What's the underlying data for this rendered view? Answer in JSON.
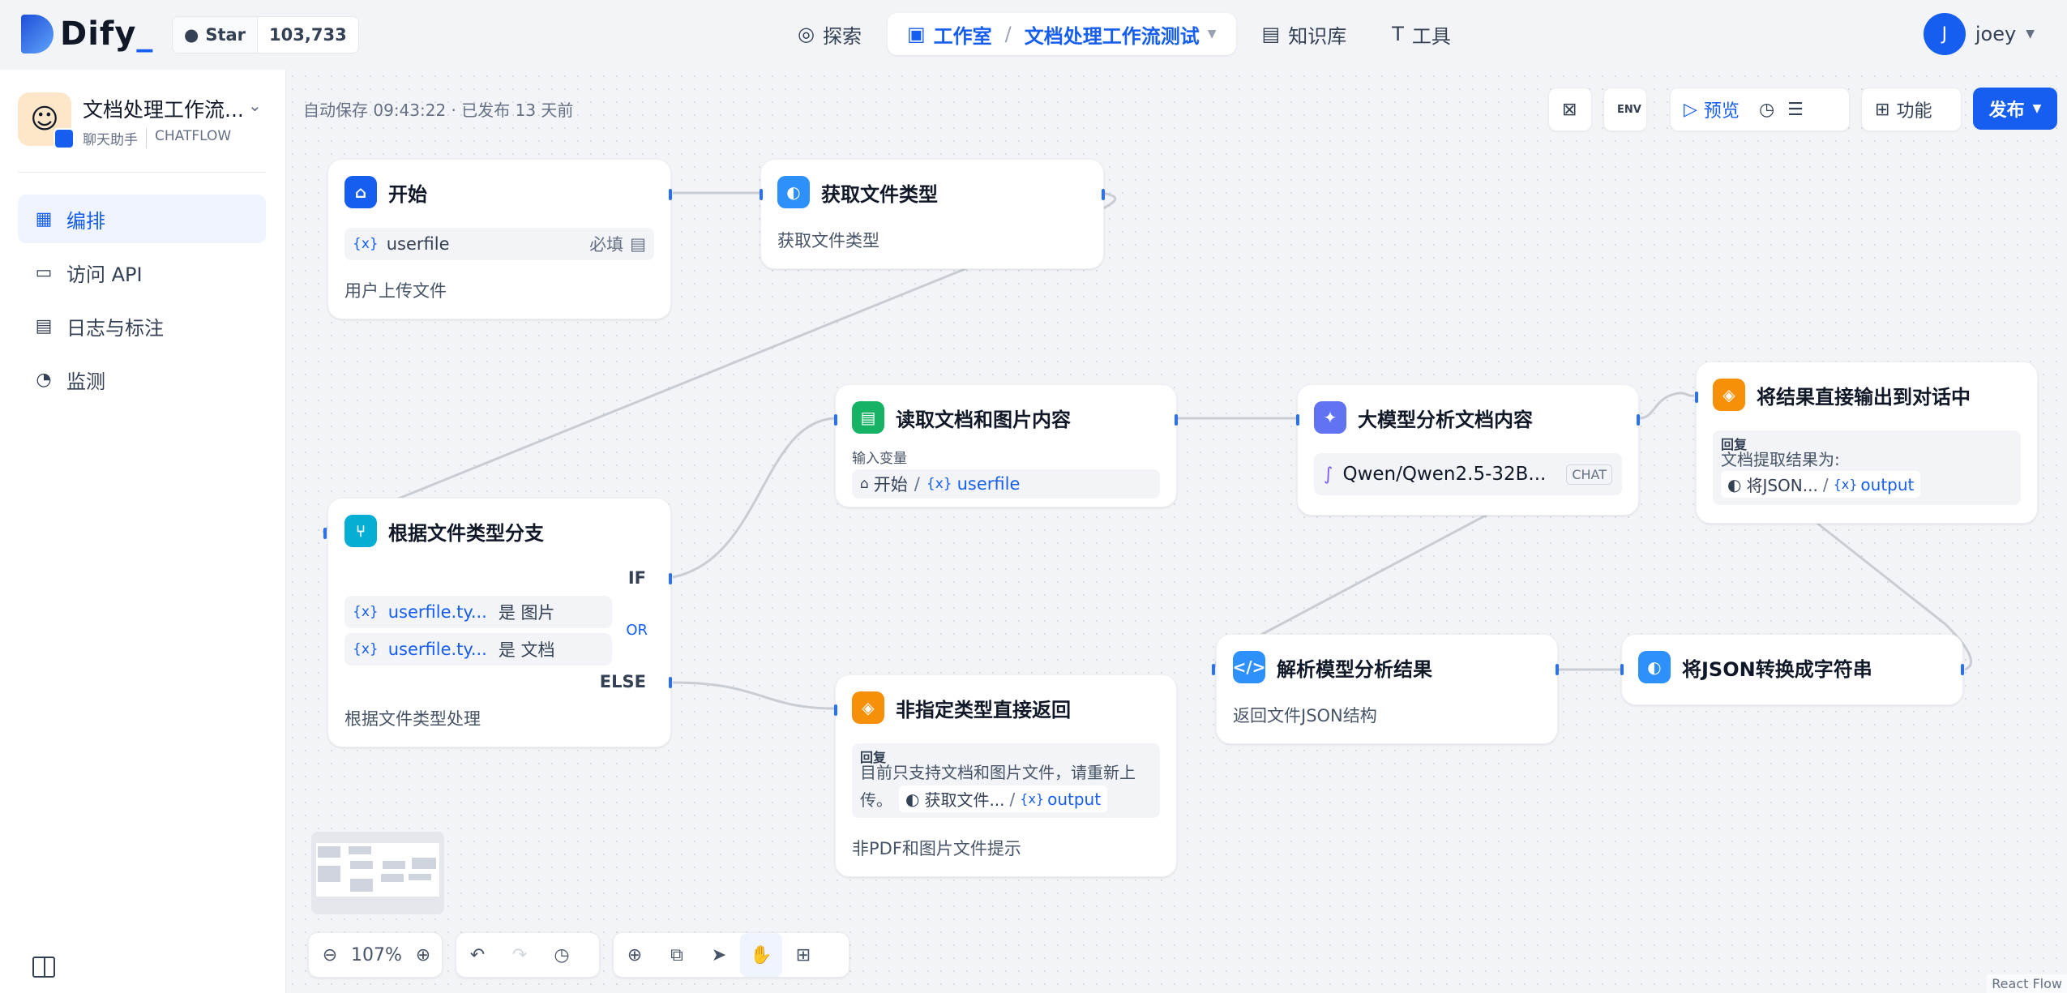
{
  "brand": {
    "logo_text": "Dify",
    "logo_underscore": "_"
  },
  "github": {
    "label": "Star",
    "count": "103,733"
  },
  "nav": {
    "explore": "探索",
    "studio": "工作室",
    "current_app": "文档处理工作流测试",
    "knowledge": "知识库",
    "tools": "工具"
  },
  "user": {
    "initial": "J",
    "name": "joey"
  },
  "app": {
    "title": "文档处理工作流...",
    "type": "聊天助手",
    "mode": "CHATFLOW"
  },
  "sidebar": {
    "items": [
      {
        "label": "编排"
      },
      {
        "label": "访问 API"
      },
      {
        "label": "日志与标注"
      },
      {
        "label": "监测"
      }
    ]
  },
  "status": "自动保存 09:43:22 · 已发布 13 天前",
  "toolbar": {
    "env": "ENV",
    "preview": "预览",
    "features": "功能",
    "publish": "发布"
  },
  "nodes": {
    "start": {
      "title": "开始",
      "var": "userfile",
      "required": "必填",
      "desc": "用户上传文件"
    },
    "get_type": {
      "title": "获取文件类型",
      "desc": "获取文件类型"
    },
    "branch": {
      "title": "根据文件类型分支",
      "if": "IF",
      "cond1_var": "userfile.ty...",
      "cond1_op": "是 图片",
      "cond2_var": "userfile.ty...",
      "cond2_op": "是 文档",
      "or": "OR",
      "else": "ELSE",
      "desc": "根据文件类型处理"
    },
    "read_doc": {
      "title": "读取文档和图片内容",
      "input_label": "输入变量",
      "src_node": "开始",
      "src_var": "userfile"
    },
    "llm": {
      "title": "大模型分析文档内容",
      "model": "Qwen/Qwen2.5-32B...",
      "mode": "CHAT"
    },
    "answer_result": {
      "title": "将结果直接输出到对话中",
      "label": "回复",
      "text": "文档提取结果为:",
      "ref_node": "将JSON...",
      "ref_var": "output"
    },
    "answer_unsupported": {
      "title": "非指定类型直接返回",
      "label": "回复",
      "text1": "目前只支持文档和图片文件，请重新上",
      "text2": "传。",
      "ref_node": "获取文件...",
      "ref_var": "output",
      "desc": "非PDF和图片文件提示"
    },
    "parse": {
      "title": "解析模型分析结果",
      "desc": "返回文件JSON结构"
    },
    "json_str": {
      "title": "将JSON转换成字符串"
    }
  },
  "zoom": "107%",
  "footer": {
    "react_flow": "React Flow"
  },
  "colors": {
    "accent": "#155eef",
    "answer": "#f79009",
    "code": "#2e90fa",
    "doc": "#16b364",
    "branch": "#06aed4",
    "llm": "#6172f3"
  }
}
